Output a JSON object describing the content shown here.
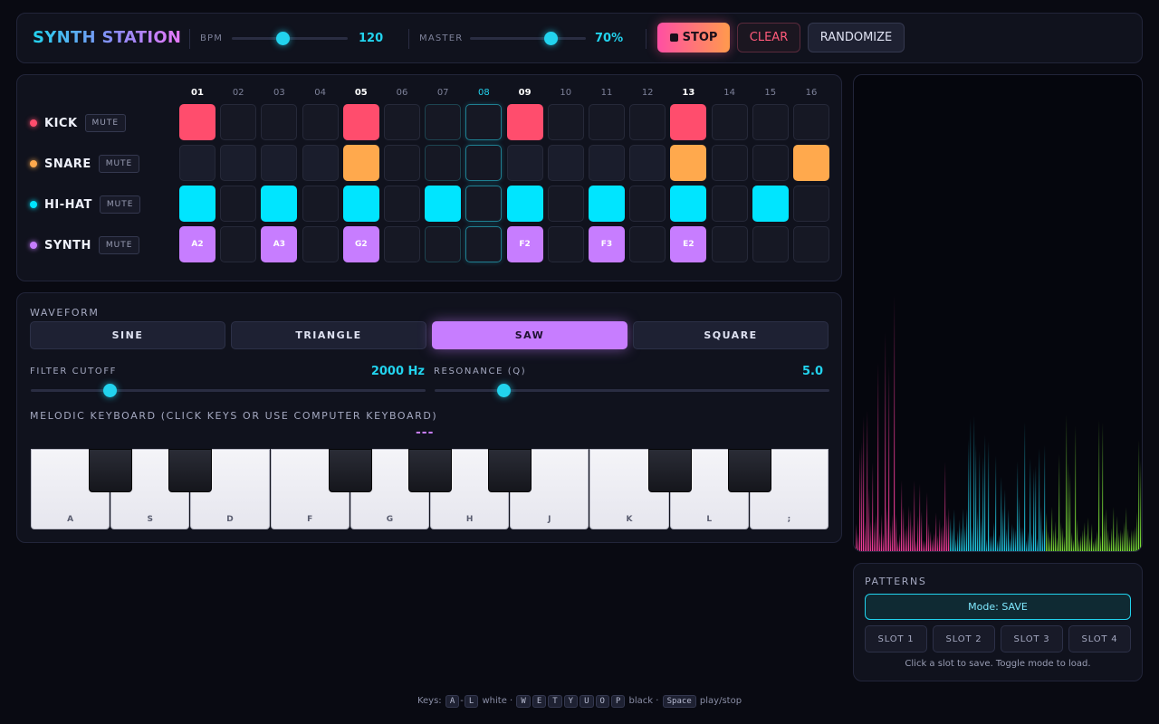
{
  "app": {
    "title": "SYNTH STATION"
  },
  "transport": {
    "bpm_label": "BPM",
    "bpm_value": "120",
    "bpm_fraction": 0.44,
    "master_label": "MASTER",
    "master_value": "70%",
    "master_fraction": 0.7,
    "stop_label": "STOP",
    "clear_label": "CLEAR",
    "randomize_label": "RANDOMIZE"
  },
  "sequencer": {
    "step_labels": [
      "01",
      "02",
      "03",
      "04",
      "05",
      "06",
      "07",
      "08",
      "09",
      "10",
      "11",
      "12",
      "13",
      "14",
      "15",
      "16"
    ],
    "current_step": 8,
    "mute_label": "MUTE",
    "tracks": [
      {
        "name": "KICK",
        "color": "#ff4d6d",
        "kind": "kick",
        "steps": [
          1,
          0,
          0,
          0,
          1,
          0,
          0,
          0,
          1,
          0,
          0,
          0,
          1,
          0,
          0,
          0
        ],
        "notes": []
      },
      {
        "name": "SNARE",
        "color": "#ffa94d",
        "kind": "snare",
        "steps": [
          0,
          0,
          0,
          0,
          1,
          0,
          0,
          0,
          0,
          0,
          0,
          0,
          1,
          0,
          0,
          1
        ],
        "notes": []
      },
      {
        "name": "HI-HAT",
        "color": "#00e5ff",
        "kind": "hat",
        "steps": [
          1,
          0,
          1,
          0,
          1,
          0,
          1,
          0,
          1,
          0,
          1,
          0,
          1,
          0,
          1,
          0
        ],
        "notes": []
      },
      {
        "name": "SYNTH",
        "color": "#c77dff",
        "kind": "synth",
        "steps": [
          1,
          0,
          1,
          0,
          1,
          0,
          0,
          0,
          1,
          0,
          1,
          0,
          1,
          0,
          0,
          0
        ],
        "notes": [
          "A2",
          "",
          "A3",
          "",
          "G2",
          "",
          "",
          "",
          "F2",
          "",
          "F3",
          "",
          "E2",
          "",
          "",
          ""
        ]
      }
    ]
  },
  "synth": {
    "waveform_label": "WAVEFORM",
    "waveforms": [
      "SINE",
      "TRIANGLE",
      "SAW",
      "SQUARE"
    ],
    "active_waveform": "SAW",
    "filter_label": "FILTER CUTOFF",
    "filter_value": "2000 Hz",
    "filter_fraction": 0.2,
    "resonance_label": "RESONANCE (Q)",
    "resonance_value": "5.0",
    "resonance_fraction": 0.175,
    "keyboard_label": "MELODIC KEYBOARD (CLICK KEYS OR USE COMPUTER KEYBOARD)",
    "note_display": "---",
    "white_keys": [
      "A",
      "S",
      "D",
      "F",
      "G",
      "H",
      "J",
      "K",
      "L",
      ";"
    ],
    "black_keys": [
      "W",
      "E",
      "T",
      "Y",
      "U",
      "O",
      "P"
    ]
  },
  "patterns": {
    "title": "PATTERNS",
    "mode_label": "Mode: SAVE",
    "slots": [
      "SLOT 1",
      "SLOT 2",
      "SLOT 3",
      "SLOT 4"
    ],
    "hint": "Click a slot to save. Toggle mode to load."
  },
  "footer": {
    "keys_label": "Keys:",
    "white_range": [
      "A",
      "L"
    ],
    "white_label": "white",
    "black_keys": [
      "W",
      "E",
      "T",
      "Y",
      "U",
      "O",
      "P"
    ],
    "black_label": "black",
    "space_key": "Space",
    "space_label": "play/stop"
  }
}
